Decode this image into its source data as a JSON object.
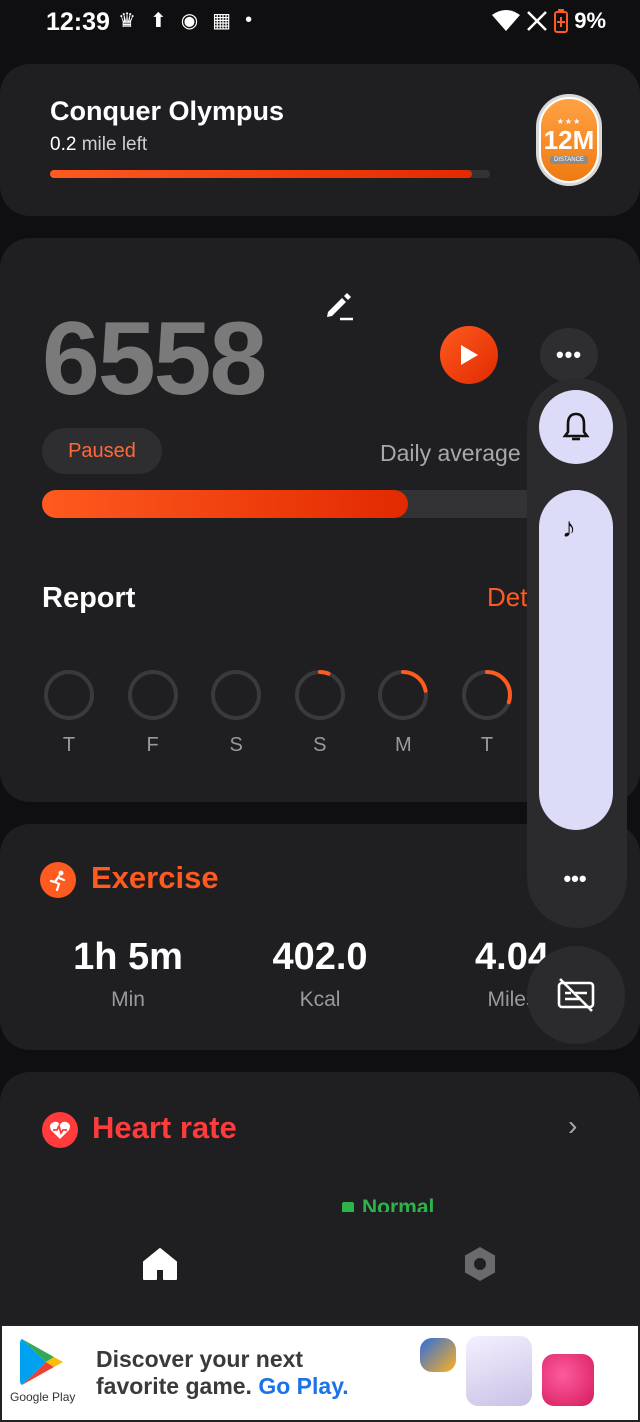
{
  "status": {
    "time": "12:39",
    "battery": "9%"
  },
  "challenge": {
    "title": "Conquer Olympus",
    "value": "0.2",
    "unit": "mile left",
    "progress": 0.96,
    "badge_text": "12M",
    "badge_sub": "DISTANCE"
  },
  "steps": {
    "count": "6558",
    "status": "Paused",
    "daily_label": "Daily average",
    "progress": 0.69
  },
  "report": {
    "title": "Report",
    "details_link": "Details",
    "days": [
      {
        "label": "T",
        "progress": 0
      },
      {
        "label": "F",
        "progress": 0
      },
      {
        "label": "S",
        "progress": 0
      },
      {
        "label": "S",
        "progress": 0.06
      },
      {
        "label": "M",
        "progress": 0.22
      },
      {
        "label": "T",
        "progress": 0.3
      }
    ]
  },
  "exercise": {
    "title": "Exercise",
    "stats": [
      {
        "value": "1h 5m",
        "unit": "Min"
      },
      {
        "value": "402.0",
        "unit": "Kcal"
      },
      {
        "value": "4.04",
        "unit": "Miles"
      }
    ]
  },
  "heart_rate": {
    "title": "Heart rate",
    "status": "Normal"
  },
  "ad": {
    "brand": "Google Play",
    "line1": "Discover your next",
    "line2": "favorite game.",
    "cta": "Go Play."
  },
  "colors": {
    "accent": "#ff5a1f",
    "heart": "#ff3b3b",
    "normal": "#2db34a",
    "panel": "#dcdcf8"
  }
}
